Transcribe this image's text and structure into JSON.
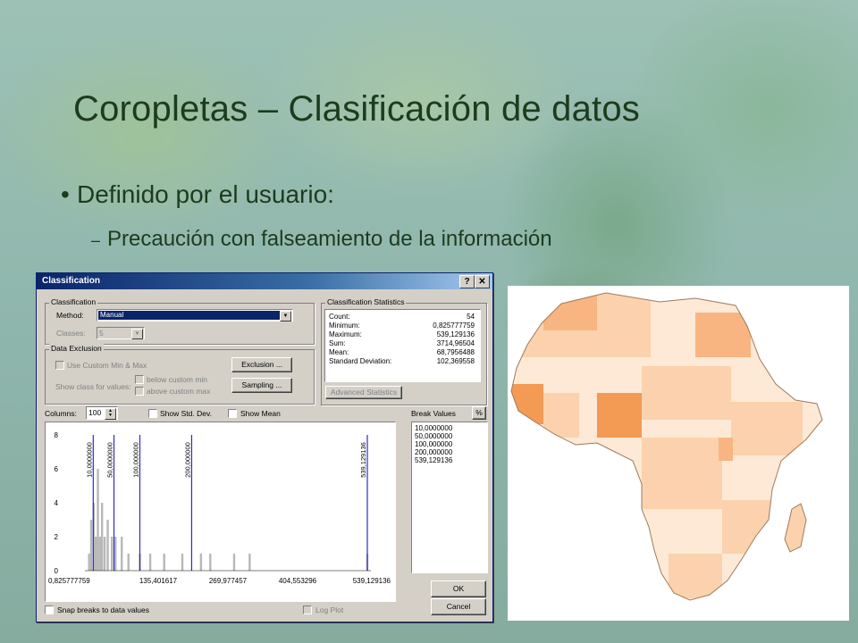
{
  "slide": {
    "title": "Coropletas – Clasificación de datos",
    "bullet": "Definido por el usuario:",
    "subbullet_dash": "–",
    "subbullet": "Precaución con falseamiento de la información"
  },
  "dialog": {
    "title": "Classification",
    "help_btn": "?",
    "close_btn": "✕",
    "classification_group": "Classification",
    "method_label": "Method:",
    "method_value": "Manual",
    "classes_label": "Classes:",
    "classes_value": "5",
    "stats_group": "Classification Statistics",
    "stats": [
      {
        "k": "Count:",
        "v": "54"
      },
      {
        "k": "Minimum:",
        "v": "0,825777759"
      },
      {
        "k": "Maximum:",
        "v": "539,129136"
      },
      {
        "k": "Sum:",
        "v": "3714,96504"
      },
      {
        "k": "Mean:",
        "v": "68,7956488"
      },
      {
        "k": "Standard Deviation:",
        "v": "102,369558"
      }
    ],
    "advanced_stats_btn": "Advanced Statistics",
    "exclusion_group": "Data Exclusion",
    "custom_minmax": "Use Custom Min & Max",
    "show_class_for": "Show class for values:",
    "below_min": "below custom min",
    "above_max": "above custom max",
    "exclusion_btn": "Exclusion ...",
    "sampling_btn": "Sampling ...",
    "columns_label": "Columns:",
    "columns_value": "100",
    "show_std": "Show Std. Dev.",
    "show_mean": "Show Mean",
    "break_values_label": "Break Values",
    "percent_btn": "%",
    "break_values": [
      "10,0000000",
      "50,0000000",
      "100,000000",
      "200,000000",
      "539,129136"
    ],
    "snap_label": "Snap breaks to data values",
    "logplot_label": "Log Plot",
    "ok_btn": "OK",
    "cancel_btn": "Cancel"
  },
  "chart_data": {
    "type": "bar",
    "title": "",
    "xlim": [
      0.825777759,
      539.129136
    ],
    "ylim": [
      0,
      8
    ],
    "x_ticks": [
      "0,825777759",
      "135,401617",
      "269,977457",
      "404,553296",
      "539,129136"
    ],
    "y_ticks": [
      "0",
      "2",
      "4",
      "6",
      "8"
    ],
    "bins_x": [
      2,
      6,
      11,
      15,
      19,
      23,
      27,
      32,
      38,
      46,
      53,
      65,
      78,
      100,
      120,
      147,
      182,
      218,
      236,
      282,
      312,
      539
    ],
    "bins_count": [
      1,
      3,
      4,
      2,
      6,
      2,
      4,
      2,
      3,
      2,
      2,
      2,
      1,
      1,
      1,
      1,
      1,
      1,
      1,
      1,
      1,
      1
    ],
    "break_lines": [
      10,
      50,
      100,
      200,
      539.129136
    ],
    "break_labels": [
      "10,0000000",
      "50,0000000",
      "100,000000",
      "200,000000",
      "539,129136"
    ]
  },
  "colors": {
    "title_bar": "#0a246a",
    "break_line": "#2b2bd1",
    "histogram_bar": "#b8b8b8",
    "map_class_1": "#fde9d6",
    "map_class_2": "#fbd2ad",
    "map_class_3": "#f8b582",
    "map_class_4": "#f39a55",
    "map_class_5": "#e8782b"
  }
}
